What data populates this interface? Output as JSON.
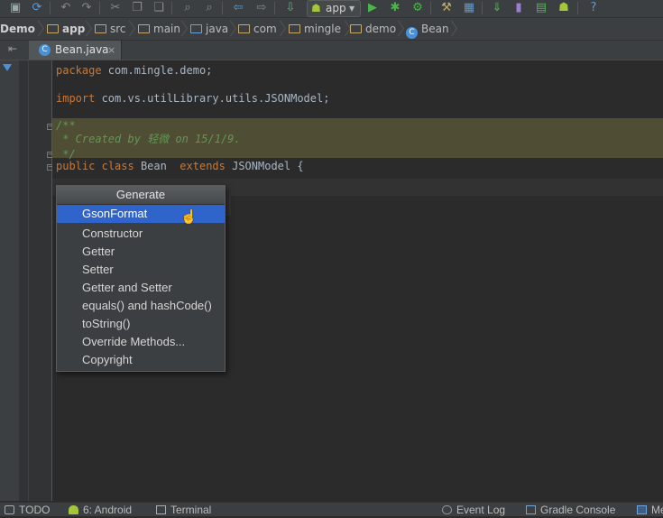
{
  "toolbar": {
    "run_config_label": "app",
    "icons": [
      "save-icon",
      "sync-icon",
      "undo-icon",
      "redo-icon",
      "cut-icon",
      "copy-icon",
      "paste-icon",
      "find-icon",
      "replace-icon",
      "back-icon",
      "forward-icon",
      "make-project-icon",
      "run-icon",
      "debug-icon",
      "attach-debugger-icon",
      "project-structure-icon",
      "sdk-manager-icon",
      "avd-manager-icon",
      "android-device-monitor-icon",
      "help-icon"
    ]
  },
  "breadcrumb": {
    "items": [
      {
        "label": "Demo",
        "icon": "project-icon"
      },
      {
        "label": "app",
        "icon": "module-folder-icon"
      },
      {
        "label": "src",
        "icon": "folder-icon"
      },
      {
        "label": "main",
        "icon": "folder-icon"
      },
      {
        "label": "java",
        "icon": "source-folder-icon"
      },
      {
        "label": "com",
        "icon": "package-icon"
      },
      {
        "label": "mingle",
        "icon": "package-icon"
      },
      {
        "label": "demo",
        "icon": "package-icon"
      },
      {
        "label": "Bean",
        "icon": "class-icon"
      }
    ]
  },
  "tabs": [
    {
      "label": "Bean.java",
      "icon_letter": "C",
      "close": "×"
    }
  ],
  "editor": {
    "line1_kw": "package",
    "line1_rest": " com.mingle.demo;",
    "line2_kw": "import",
    "line2_rest": " com.vs.utilLibrary.utils.JSONModel;",
    "comment_open": "/**",
    "comment_body": " * Created by 轻微 on 15/1/9.",
    "comment_close": " */",
    "class_kw1": "public",
    "class_kw2": "class",
    "class_name": " Bean  ",
    "class_kw3": "extends",
    "class_rest": " JSONModel {"
  },
  "popup": {
    "title": "Generate",
    "selected": "GsonFormat",
    "items": [
      "Constructor",
      "Getter",
      "Setter",
      "Getter and Setter",
      "equals() and hashCode()",
      "toString()",
      "Override Methods...",
      "Copyright"
    ],
    "cursor_icon": "hand-pointer-icon"
  },
  "statusbar": {
    "todo": "TODO",
    "android": "6: Android",
    "terminal": "Terminal",
    "event_log": "Event Log",
    "gradle_console": "Gradle Console",
    "messages": "Me"
  },
  "colors": {
    "background": "#2b2b2b",
    "chrome": "#3c3f41",
    "keyword": "#cc7832",
    "comment": "#629755",
    "selection": "#2f65ca",
    "comment_highlight": "#4f4d33"
  }
}
